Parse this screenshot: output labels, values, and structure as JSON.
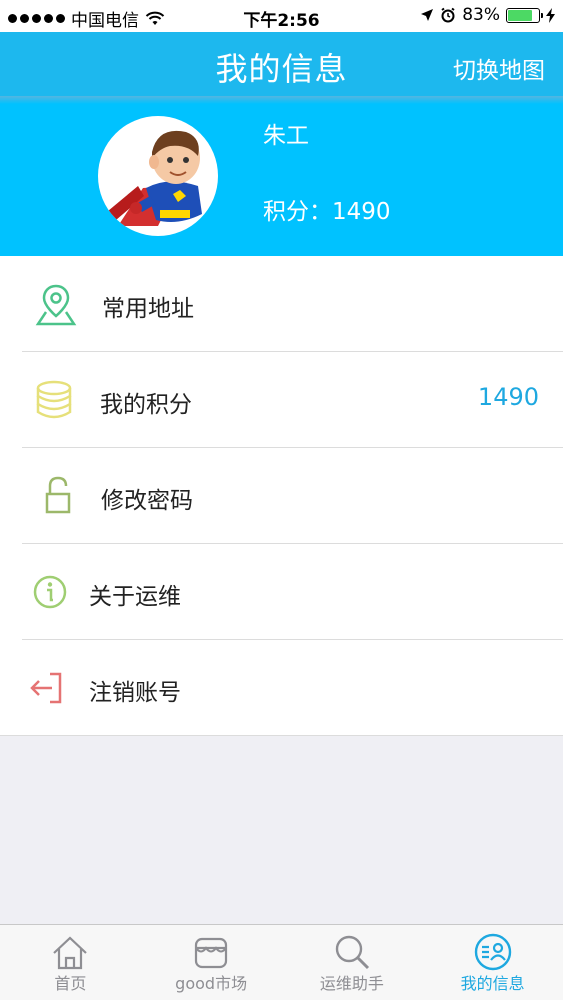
{
  "status_bar": {
    "carrier": "中国电信",
    "time": "下午2:56",
    "battery_percent": "83%",
    "battery_level": 0.83
  },
  "nav": {
    "title": "我的信息",
    "right_button": "切换地图"
  },
  "profile": {
    "name": "朱工",
    "points_label": "积分：",
    "points_value": "1490"
  },
  "menu": {
    "items": [
      {
        "label": "常用地址",
        "icon": "map-pin-icon",
        "color": "#4cc38a"
      },
      {
        "label": "我的积分",
        "icon": "coins-icon",
        "color": "#e6e07a",
        "value": "1490"
      },
      {
        "label": "修改密码",
        "icon": "unlock-icon",
        "color": "#9cb86a"
      },
      {
        "label": "关于运维",
        "icon": "info-icon",
        "color": "#9fce72"
      },
      {
        "label": "注销账号",
        "icon": "logout-icon",
        "color": "#e57373"
      }
    ]
  },
  "tabs": [
    {
      "label": "首页",
      "icon": "home-icon",
      "active": false
    },
    {
      "label": "good市场",
      "icon": "store-icon",
      "active": false
    },
    {
      "label": "运维助手",
      "icon": "search-icon",
      "active": false
    },
    {
      "label": "我的信息",
      "icon": "profile-list-icon",
      "active": true
    }
  ],
  "colors": {
    "nav_bg": "#1db8ee",
    "profile_bg": "#00c2ff",
    "accent": "#1ea8e0",
    "inactive": "#8e8e93"
  }
}
